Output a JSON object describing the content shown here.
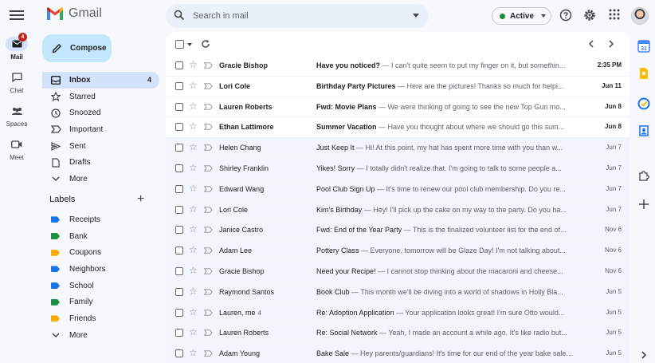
{
  "app": {
    "name": "Gmail"
  },
  "search": {
    "placeholder": "Search in mail"
  },
  "status": {
    "label": "Active",
    "color": "#1e8e3e"
  },
  "icons": {
    "help": "help-icon",
    "settings": "gear-icon",
    "apps": "apps-grid-icon"
  },
  "rail": [
    {
      "label": "Mail",
      "icon": "mail-icon",
      "badge": "4",
      "active": true
    },
    {
      "label": "Chat",
      "icon": "chat-icon"
    },
    {
      "label": "Spaces",
      "icon": "spaces-icon"
    },
    {
      "label": "Meet",
      "icon": "video-icon"
    }
  ],
  "compose": {
    "label": "Compose"
  },
  "nav": [
    {
      "label": "Inbox",
      "icon": "inbox-icon",
      "count": "4",
      "active": true
    },
    {
      "label": "Starred",
      "icon": "star-icon"
    },
    {
      "label": "Snoozed",
      "icon": "clock-icon"
    },
    {
      "label": "Important",
      "icon": "important-icon"
    },
    {
      "label": "Sent",
      "icon": "send-icon"
    },
    {
      "label": "Drafts",
      "icon": "draft-icon"
    },
    {
      "label": "More",
      "icon": "chevron-down-icon"
    }
  ],
  "labels": {
    "title": "Labels",
    "items": [
      {
        "label": "Receipts",
        "color": "#1a73e8"
      },
      {
        "label": "Bank",
        "color": "#1e8e3e"
      },
      {
        "label": "Coupons",
        "color": "#f9ab00"
      },
      {
        "label": "Neighbors",
        "color": "#1a73e8"
      },
      {
        "label": "School",
        "color": "#1a73e8"
      },
      {
        "label": "Family",
        "color": "#1e8e3e"
      },
      {
        "label": "Friends",
        "color": "#f9ab00"
      }
    ],
    "more": "More"
  },
  "emails": [
    {
      "sender": "Gracie Bishop",
      "subject": "Have you noticed?",
      "snippet": " — I can't quite seem to put my finger on it, but somethin...",
      "date": "2:35 PM",
      "unread": true
    },
    {
      "sender": "Lori Cole",
      "subject": "Birthday Party Pictures",
      "snippet": " — Here are the pictures! Thanks so much for helpi...",
      "date": "Jun 11",
      "unread": true
    },
    {
      "sender": "Lauren Roberts",
      "subject": "Fwd: Movie Plans",
      "snippet": " — We were thinking of going to see the new Top Gun mo...",
      "date": "Jun 8",
      "unread": true
    },
    {
      "sender": "Ethan Lattimore",
      "subject": "Summer Vacation",
      "snippet": " — Have you thought about where we should go this sum...",
      "date": "Jun 8",
      "unread": true
    },
    {
      "sender": "Helen Chang",
      "subject": "Just Keep It",
      "snippet": " — Hi! At this point, my hat has spent more time with you than w...",
      "date": "Jun 7",
      "unread": false
    },
    {
      "sender": "Shirley Franklin",
      "subject": "Yikes! Sorry",
      "snippet": " — I totally didn't realize that. I'm going to talk to some people a...",
      "date": "Jun 7",
      "unread": false
    },
    {
      "sender": "Edward Wang",
      "subject": "Pool Club Sign Up",
      "snippet": " — It's time to renew our pool club membership. Do you re...",
      "date": "Jun 7",
      "unread": false
    },
    {
      "sender": "Lori Cole",
      "subject": "Kim's Birthday",
      "snippet": " — Hey! I'll pick up the cake on my way to the party. Do you ha...",
      "date": "Jun 7",
      "unread": false
    },
    {
      "sender": "Janice Castro",
      "subject": "Fwd: End of the Year Party",
      "snippet": " — This is the finalized volunteer list for the end of...",
      "date": "Nov 6",
      "unread": false
    },
    {
      "sender": "Adam Lee",
      "subject": "Pottery Class",
      "snippet": " — Everyone, tomorrow will be Glaze Day! I'm not talking about...",
      "date": "Nov 6",
      "unread": false
    },
    {
      "sender": "Gracie Bishop",
      "subject": "Need your Recipe!",
      "snippet": " — I cannot stop thinking about the macaroni and cheese...",
      "date": "Nov 6",
      "unread": false
    },
    {
      "sender": "Raymond Santos",
      "subject": "Book Club",
      "snippet": " — This month we'll be diving into a world of shadows in Holly Bla...",
      "date": "Jun 5",
      "unread": false
    },
    {
      "sender": "Lauren, me",
      "count": "4",
      "subject": "Re: Adoption Application",
      "snippet": " — Your application looks great! I'm sure Otto would...",
      "date": "Jun 5",
      "unread": false
    },
    {
      "sender": "Lauren Roberts",
      "subject": "Re: Social Network",
      "snippet": " — Yeah, I made an account a while ago. It's like radio but...",
      "date": "Jun 5",
      "unread": false
    },
    {
      "sender": "Adam Young",
      "subject": "Bake Sale",
      "snippet": " — Hey parents/guardians! It's time for our end of the year bake sale...",
      "date": "Jun 5",
      "unread": false
    }
  ]
}
